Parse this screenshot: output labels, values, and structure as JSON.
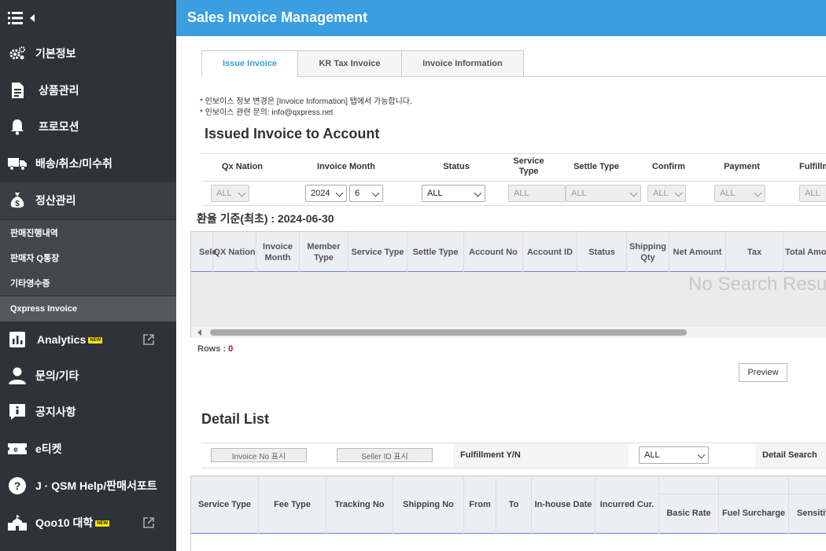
{
  "sidebar": {
    "items": [
      {
        "label": "기본정보",
        "icon": "gears-icon"
      },
      {
        "label": "상품관리",
        "icon": "document-icon"
      },
      {
        "label": "프로모션",
        "icon": "bell-icon"
      },
      {
        "label": "배송/취소/미수취",
        "icon": "truck-icon"
      },
      {
        "label": "정산관리",
        "icon": "money-bag-icon"
      },
      {
        "label": "Analytics",
        "icon": "bar-chart-icon",
        "badge": "NEW"
      },
      {
        "label": "문의/기타",
        "icon": "user-icon"
      },
      {
        "label": "공지사항",
        "icon": "notice-icon"
      },
      {
        "label": "e티켓",
        "icon": "eticket-icon"
      },
      {
        "label": "J · QSM Help/판매서포트",
        "icon": "help-icon"
      },
      {
        "label": "Qoo10 대학",
        "icon": "school-icon",
        "badge": "NEW"
      }
    ],
    "sub_items": [
      "판매진행내역",
      "판매자 Q통장",
      "기타영수증",
      "Qxpress Invoice"
    ]
  },
  "header": {
    "title": "Sales Invoice Management"
  },
  "tabs": [
    "Issue Invoice",
    "KR Tax Invoice",
    "Invoice Information"
  ],
  "notes": [
    "* 인보이스 정보 변경은 [Invoice Information] 탭에서 가능합니다.",
    "* 인보이스 관련 문의: info@qxpress.net"
  ],
  "section_title": "Issued Invoice to Account",
  "filters": {
    "headers": [
      "Qx Nation",
      "Invoice Month",
      "Status",
      "Service Type",
      "Settle Type",
      "Confirm",
      "Payment",
      "Fulfillm"
    ],
    "values": {
      "qx_nation": "ALL",
      "year": "2024",
      "month": "6",
      "status": "ALL",
      "service_type": "ALL",
      "settle_type": "ALL",
      "confirm": "ALL",
      "payment": "ALL",
      "fulfillment": "ALL"
    }
  },
  "rate_basis": "환율 기준(최초) : 2024-06-30",
  "grid": {
    "columns": [
      "Sele",
      "QX Nation",
      "Invoice Month",
      "Member Type",
      "Service Type",
      "Settle Type",
      "Account No",
      "Account ID",
      "Status",
      "Shipping Qty",
      "Net Amount",
      "Tax",
      "Total Amoun"
    ],
    "empty_text": "No Search Result"
  },
  "rows_label": "Rows : ",
  "rows_count": "0",
  "preview_label": "Preview",
  "detail": {
    "title": "Detail List",
    "invoice_no_btn": "Invoice No 표시",
    "seller_id_btn": "Seller ID 표시",
    "fulfillment_label": "Fulfillment Y/N",
    "fulfillment_value": "ALL",
    "detail_search": "Detail Search",
    "columns": [
      "Service Type",
      "Fee Type",
      "Tracking No",
      "Shipping No",
      "From",
      "To",
      "In-house Date",
      "Incurred Cur.",
      "Basic Rate",
      "Fuel Surcharge",
      "Sensitiv"
    ]
  }
}
